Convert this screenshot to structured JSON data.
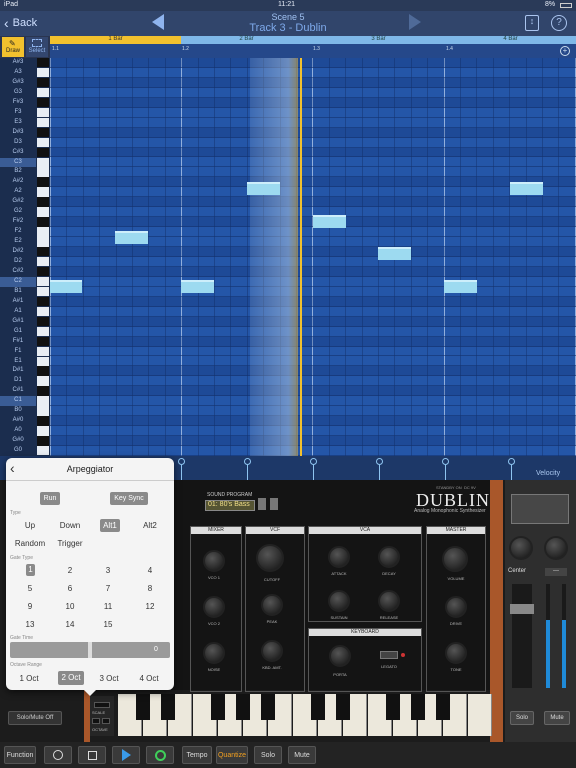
{
  "status": {
    "device": "iPad",
    "time": "11:21",
    "battery": "8%"
  },
  "nav": {
    "back": "Back",
    "scene": "Scene  5",
    "track": "Track 3 - Dublin"
  },
  "tools": {
    "draw": "Draw",
    "select": "Select"
  },
  "ruler": {
    "bars": [
      "1 Bar",
      "2 Bar",
      "3 Bar",
      "4 Bar"
    ],
    "positions": [
      "1.1",
      "1.2",
      "1.3",
      "1.4"
    ]
  },
  "keys": [
    "A#3",
    "A3",
    "G#3",
    "G3",
    "F#3",
    "F3",
    "E3",
    "D#3",
    "D3",
    "C#3",
    "C3",
    "B2",
    "A#2",
    "A2",
    "G#2",
    "G2",
    "F#2",
    "F2",
    "E2",
    "D#2",
    "D2",
    "C#2",
    "C2",
    "B1",
    "A#1",
    "A1",
    "G#1",
    "G1",
    "F#1",
    "F1",
    "E1",
    "D#1",
    "D1",
    "C#1",
    "C1",
    "B0",
    "A#0",
    "A0",
    "G#0",
    "G0"
  ],
  "velocity_label": "Velocity",
  "arp": {
    "title": "Arpeggiator",
    "run": "Run",
    "keysync": "Key Sync",
    "type_label": "Type",
    "types": [
      "Up",
      "Down",
      "Alt1",
      "Alt2",
      "Random",
      "Trigger"
    ],
    "selected_type": "Alt1",
    "gate_type_label": "Gate Type",
    "gates": [
      "1",
      "2",
      "3",
      "4",
      "5",
      "6",
      "7",
      "8",
      "9",
      "10",
      "11",
      "12",
      "13",
      "14",
      "15"
    ],
    "selected_gate": "1",
    "gate_time_label": "Gate Time",
    "gate_time_value": "0",
    "octave_label": "Octave Range",
    "octaves": [
      "1 Oct",
      "2 Oct",
      "3 Oct",
      "4 Oct"
    ],
    "selected_octave": "2 Oct"
  },
  "synth": {
    "brand": "DUBLIN",
    "subtitle": "Analog Monophonic Synthesizer",
    "sound_program_label": "SOUND PROGRAM",
    "program": "01: 80's Bass",
    "sections": [
      "MIXER",
      "VCF",
      "VCA",
      "MASTER",
      "KEYBOARD"
    ],
    "mixer_knobs": [
      "VCO 1",
      "VCO 2",
      "NOISE"
    ],
    "vcf_knobs": [
      "CUTOFF",
      "PEAK",
      "KBD. AMT."
    ],
    "vca_knobs": [
      "ATTACK",
      "DECAY",
      "SUSTAIN",
      "RELEASE"
    ],
    "master_knobs": [
      "VOLUME",
      "DRIVE",
      "TONE"
    ],
    "keyboard_knobs": [
      "PORTA",
      "LEGATO"
    ],
    "pan": "Center",
    "side_value": "---",
    "solo": "Solo",
    "mute": "Mute",
    "solo_mute_off": "Solo/Mute Off",
    "scale": "SCALE",
    "octave": "OCTAVE",
    "standby": "STANDBY ON",
    "dc": "DC 9V"
  },
  "bottombar": {
    "function": "Function",
    "tempo": "Tempo",
    "quantize": "Quantize",
    "solo": "Solo",
    "mute": "Mute"
  },
  "colors": {
    "accent": "#f2c12e",
    "note": "#9ddaf0",
    "grid": "#2456a8"
  }
}
